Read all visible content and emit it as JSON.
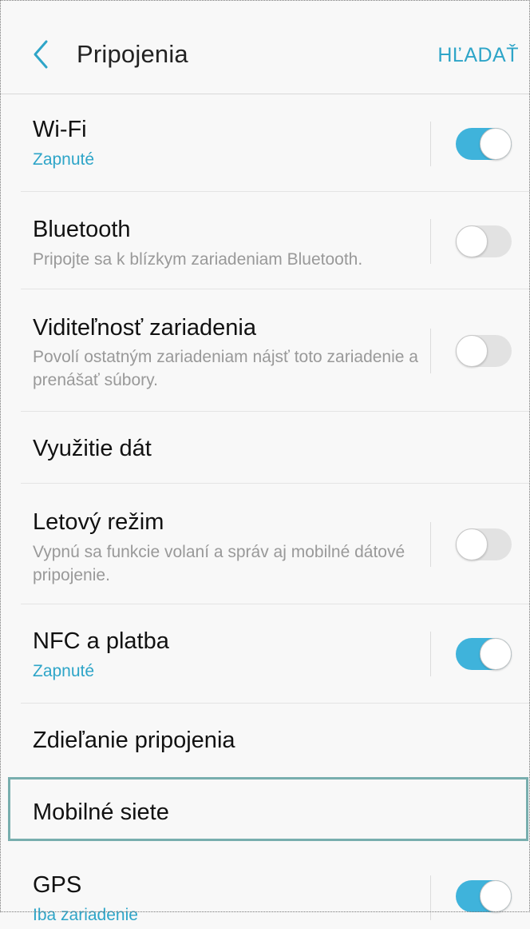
{
  "header": {
    "title": "Pripojenia",
    "search_label": "HĽADAŤ",
    "back_icon": "chevron-left-icon",
    "accent_color": "#2ea5c8"
  },
  "settings": [
    {
      "title": "Wi-Fi",
      "subtitle": "Zapnuté",
      "subtitle_active": true,
      "toggle": true,
      "toggle_on": true
    },
    {
      "title": "Bluetooth",
      "subtitle": "Pripojte sa k blízkym zariadeniam Bluetooth.",
      "subtitle_active": false,
      "toggle": true,
      "toggle_on": false
    },
    {
      "title": "Viditeľnosť zariadenia",
      "subtitle": "Povolí ostatným zariadeniam nájsť toto zariadenie a prenášať súbory.",
      "subtitle_active": false,
      "toggle": true,
      "toggle_on": false
    },
    {
      "title": "Využitie dát",
      "subtitle": "",
      "toggle": false
    },
    {
      "title": "Letový režim",
      "subtitle": "Vypnú sa funkcie volaní a správ aj mobilné dátové pripojenie.",
      "subtitle_active": false,
      "toggle": true,
      "toggle_on": false
    },
    {
      "title": "NFC a platba",
      "subtitle": "Zapnuté",
      "subtitle_active": true,
      "toggle": true,
      "toggle_on": true
    },
    {
      "title": "Zdieľanie pripojenia",
      "subtitle": "",
      "toggle": false
    },
    {
      "title": "Mobilné siete",
      "subtitle": "",
      "toggle": false,
      "highlighted": true
    },
    {
      "title": "GPS",
      "subtitle": "Iba zariadenie",
      "subtitle_active": true,
      "toggle": true,
      "toggle_on": true
    }
  ],
  "colors": {
    "toggle_on": "#3fb3db",
    "toggle_off": "#e2e2e2",
    "highlight_border": "#78aeae"
  }
}
